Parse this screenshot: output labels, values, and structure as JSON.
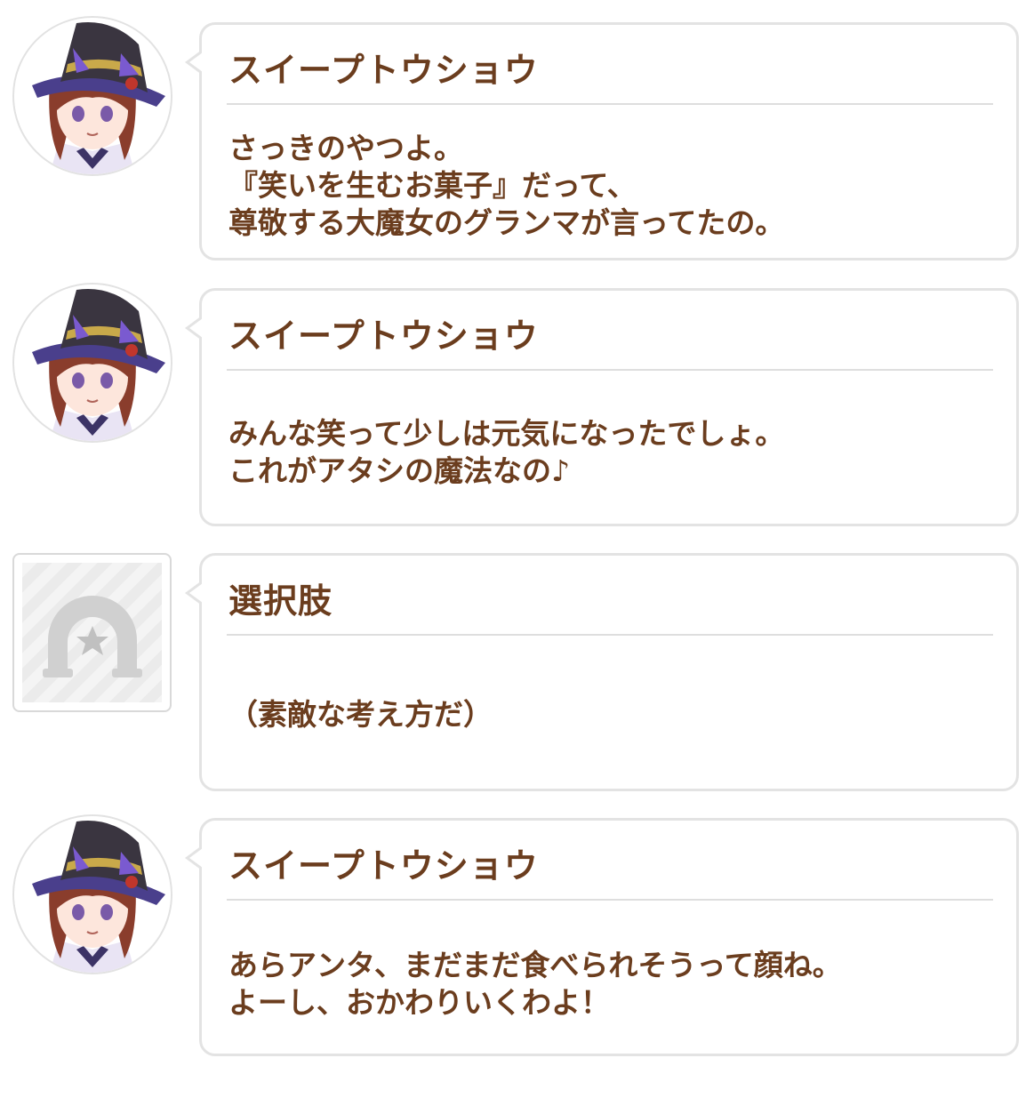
{
  "messages": [
    {
      "speaker": "スイープトウショウ",
      "avatar": "character-portrait",
      "lines": [
        "さっきのやつよ。",
        "『笑いを生むお菓子』だって、",
        "尊敬する大魔女のグランマが言ってたの。"
      ]
    },
    {
      "speaker": "スイープトウショウ",
      "avatar": "character-portrait",
      "lines": [
        "みんな笑って少しは元気になったでしょ。",
        "これがアタシの魔法なの♪"
      ]
    },
    {
      "speaker": "選択肢",
      "avatar": "horseshoe-star-icon",
      "lines": [
        "（素敵な考え方だ）"
      ]
    },
    {
      "speaker": "スイープトウショウ",
      "avatar": "character-portrait",
      "lines": [
        "あらアンタ、まだまだ食べられそうって顔ね。",
        "よーし、おかわりいくわよ！"
      ]
    }
  ],
  "colors": {
    "text": "#6b3d1e",
    "bubble_border": "#e3e3e3",
    "divider": "#dedede"
  }
}
